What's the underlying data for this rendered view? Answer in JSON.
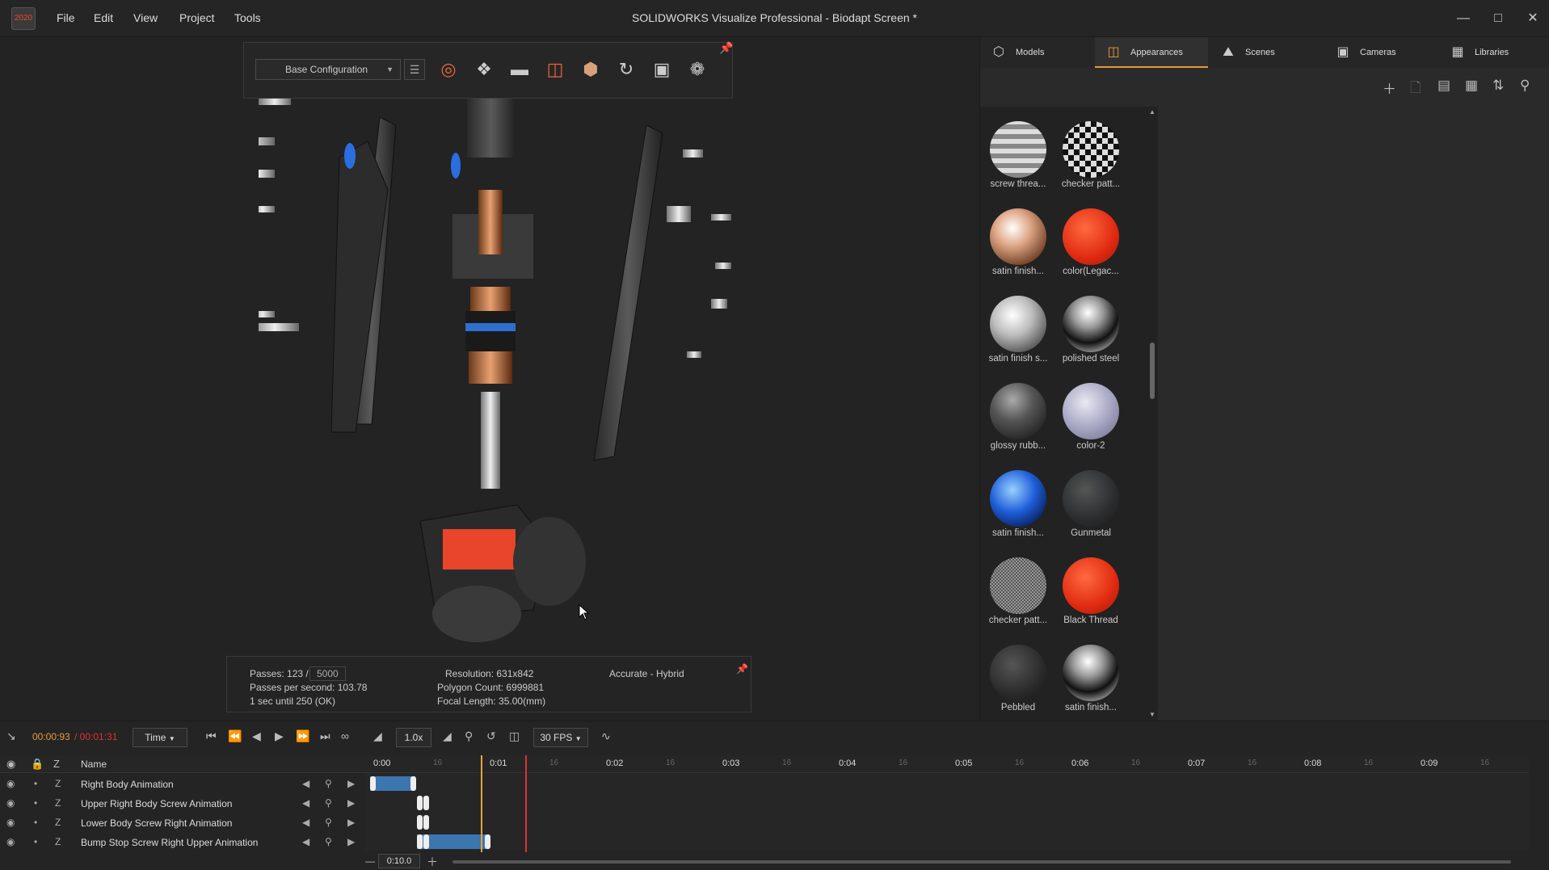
{
  "window": {
    "title": "SOLIDWORKS Visualize Professional - Biodapt Screen *",
    "menu": [
      "File",
      "Edit",
      "View",
      "Project",
      "Tools"
    ],
    "logo_text": "2020"
  },
  "toolbar": {
    "configuration": "Base Configuration",
    "tools": [
      "target-icon",
      "transform-icon",
      "floor-icon",
      "appearance-icon",
      "part-icon",
      "refresh-icon",
      "camera-box-icon",
      "aperture-icon"
    ]
  },
  "status": {
    "passes_label": "Passes: 123 /",
    "passes_max": "5000",
    "pps": "Passes per second: 103.78",
    "eta": "1 sec until 250 (OK)",
    "resolution": "Resolution: 631x842",
    "polygons": "Polygon Count: 6999881",
    "focal": "Focal Length: 35.00(mm)",
    "mode": "Accurate - Hybrid"
  },
  "panel": {
    "tabs": [
      {
        "label": "Models",
        "icon": "cube-icon"
      },
      {
        "label": "Appearances",
        "icon": "paint-can-icon",
        "active": true
      },
      {
        "label": "Scenes",
        "icon": "landscape-icon"
      },
      {
        "label": "Cameras",
        "icon": "camera-icon"
      },
      {
        "label": "Libraries",
        "icon": "books-icon"
      }
    ],
    "materials": [
      {
        "label": "screw threa..."
      },
      {
        "label": "checker patt..."
      },
      {
        "label": "satin finish..."
      },
      {
        "label": "color(Legac..."
      },
      {
        "label": "satin finish s..."
      },
      {
        "label": "polished steel"
      },
      {
        "label": "glossy rubb..."
      },
      {
        "label": "color-2"
      },
      {
        "label": "satin finish..."
      },
      {
        "label": "Gunmetal"
      },
      {
        "label": "checker patt..."
      },
      {
        "label": "Black Thread"
      },
      {
        "label": "Pebbled"
      },
      {
        "label": "satin finish..."
      }
    ]
  },
  "timeline": {
    "current_time": "00:00:93",
    "total_time": "/ 00:01:31",
    "mode": "Time",
    "speed": "1.0x",
    "fps": "30 FPS",
    "zoom_value": "0:10.0",
    "header_name": "Name",
    "ruler_labels": [
      "0:00",
      "0:01",
      "0:02",
      "0:03",
      "0:04",
      "0:05",
      "0:06",
      "0:07",
      "0:08",
      "0:09"
    ],
    "minor_label": "16",
    "tracks": [
      "Right Body Animation",
      "Upper Right Body Screw Animation",
      "Lower Body Screw Right Animation",
      "Bump Stop Screw Right Upper Animation"
    ]
  },
  "colors": {
    "accent": "#e89a3c",
    "playhead": "#e8a33c",
    "endmarker": "#e03030",
    "clip": "#3f7fbf"
  }
}
